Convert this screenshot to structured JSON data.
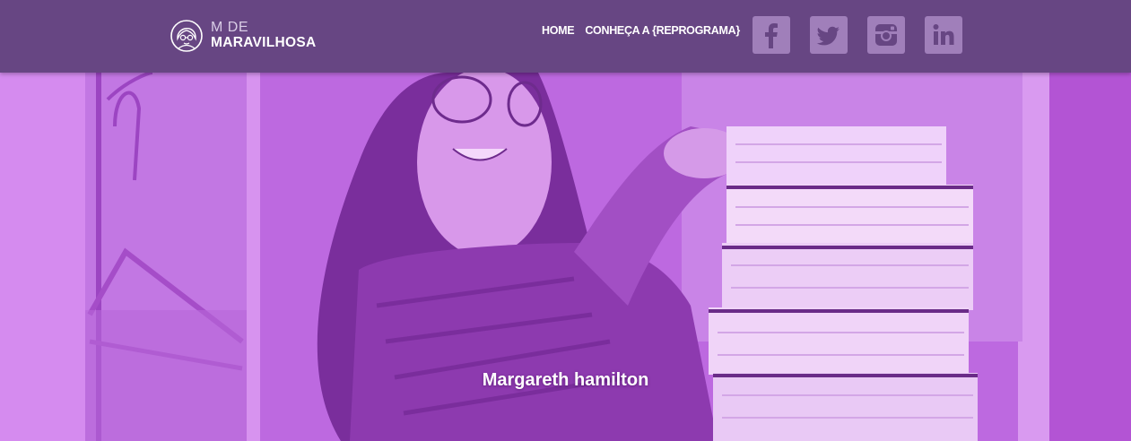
{
  "logo": {
    "line1": "M DE",
    "line2": "MARAVILHOSA"
  },
  "nav": {
    "home": "HOME",
    "conheca": "CONHEÇA A {REPROGRAMA}"
  },
  "social": {
    "color": "#a07fba",
    "items": [
      "facebook-icon",
      "twitter-icon",
      "instagram-icon",
      "linkedin-icon"
    ]
  },
  "hero": {
    "caption": "Margareth hamilton",
    "overlay_color": "#b45fd0"
  },
  "colors": {
    "header_bg": "#674683"
  }
}
